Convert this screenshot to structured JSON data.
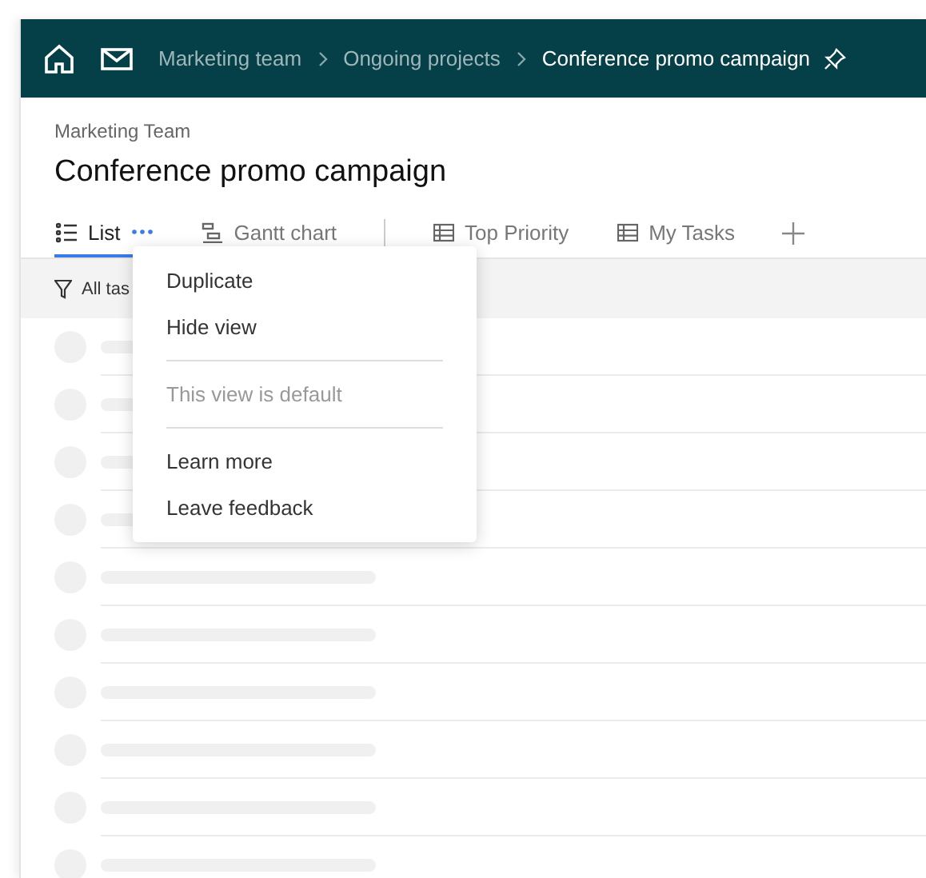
{
  "breadcrumb": [
    "Marketing team",
    "Ongoing projects",
    "Conference promo campaign"
  ],
  "page": {
    "subtitle": "Marketing Team",
    "title": "Conference promo campaign"
  },
  "tabs": [
    {
      "label": "List",
      "kind": "list",
      "selected": true
    },
    {
      "label": "Gantt chart",
      "kind": "gantt",
      "selected": false
    },
    {
      "label": "Top Priority",
      "kind": "table",
      "selected": false
    },
    {
      "label": "My Tasks",
      "kind": "table",
      "selected": false
    }
  ],
  "filter": {
    "label": "All tas"
  },
  "context_menu": [
    {
      "kind": "item",
      "label": "Duplicate",
      "disabled": false
    },
    {
      "kind": "item",
      "label": "Hide view",
      "disabled": false
    },
    {
      "kind": "separator"
    },
    {
      "kind": "item",
      "label": "This view is default",
      "disabled": true
    },
    {
      "kind": "separator"
    },
    {
      "kind": "item",
      "label": "Learn more",
      "disabled": false
    },
    {
      "kind": "item",
      "label": "Leave feedback",
      "disabled": false
    }
  ],
  "rows": [
    {
      "kind": "placeholder"
    },
    {
      "kind": "placeholder"
    },
    {
      "kind": "placeholder"
    },
    {
      "kind": "placeholder"
    },
    {
      "kind": "placeholder"
    },
    {
      "kind": "placeholder"
    },
    {
      "kind": "placeholder"
    },
    {
      "kind": "placeholder"
    },
    {
      "kind": "placeholder"
    },
    {
      "kind": "placeholder"
    }
  ]
}
